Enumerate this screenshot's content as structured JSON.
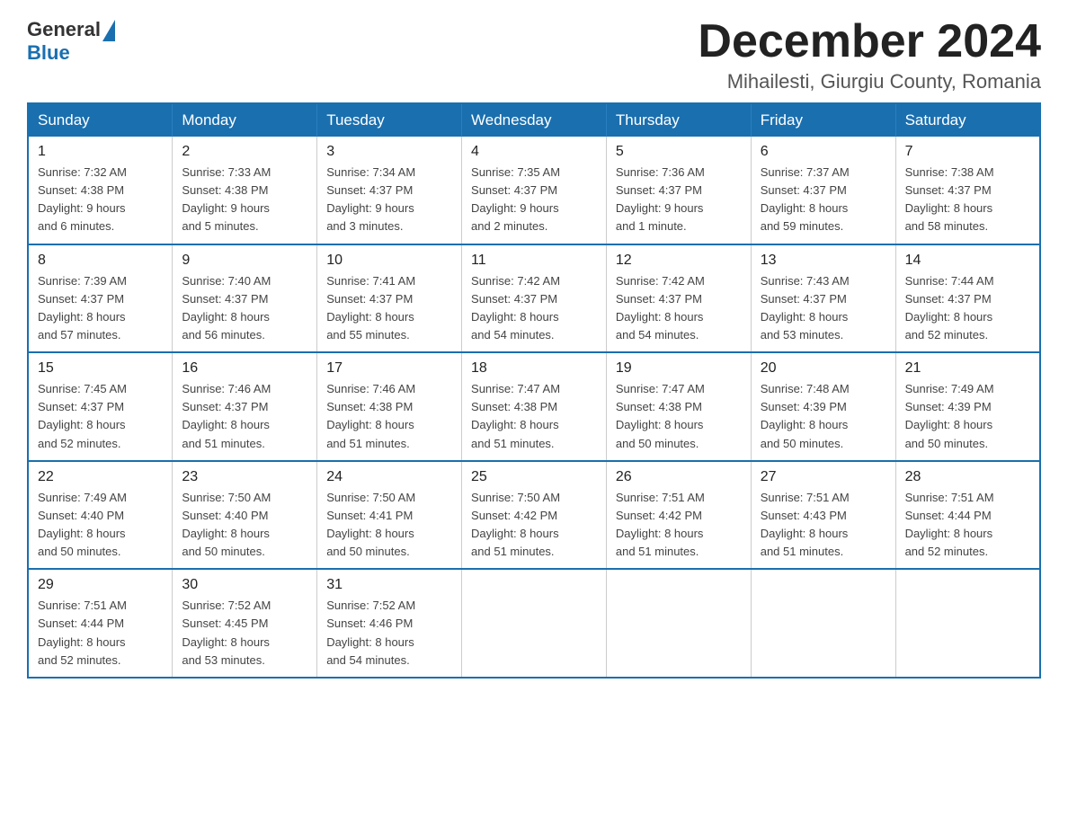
{
  "header": {
    "logo_general": "General",
    "logo_blue": "Blue",
    "month_title": "December 2024",
    "location": "Mihailesti, Giurgiu County, Romania"
  },
  "days_of_week": [
    "Sunday",
    "Monday",
    "Tuesday",
    "Wednesday",
    "Thursday",
    "Friday",
    "Saturday"
  ],
  "weeks": [
    [
      {
        "day": "1",
        "sunrise": "7:32 AM",
        "sunset": "4:38 PM",
        "daylight": "9 hours and 6 minutes."
      },
      {
        "day": "2",
        "sunrise": "7:33 AM",
        "sunset": "4:38 PM",
        "daylight": "9 hours and 5 minutes."
      },
      {
        "day": "3",
        "sunrise": "7:34 AM",
        "sunset": "4:37 PM",
        "daylight": "9 hours and 3 minutes."
      },
      {
        "day": "4",
        "sunrise": "7:35 AM",
        "sunset": "4:37 PM",
        "daylight": "9 hours and 2 minutes."
      },
      {
        "day": "5",
        "sunrise": "7:36 AM",
        "sunset": "4:37 PM",
        "daylight": "9 hours and 1 minute."
      },
      {
        "day": "6",
        "sunrise": "7:37 AM",
        "sunset": "4:37 PM",
        "daylight": "8 hours and 59 minutes."
      },
      {
        "day": "7",
        "sunrise": "7:38 AM",
        "sunset": "4:37 PM",
        "daylight": "8 hours and 58 minutes."
      }
    ],
    [
      {
        "day": "8",
        "sunrise": "7:39 AM",
        "sunset": "4:37 PM",
        "daylight": "8 hours and 57 minutes."
      },
      {
        "day": "9",
        "sunrise": "7:40 AM",
        "sunset": "4:37 PM",
        "daylight": "8 hours and 56 minutes."
      },
      {
        "day": "10",
        "sunrise": "7:41 AM",
        "sunset": "4:37 PM",
        "daylight": "8 hours and 55 minutes."
      },
      {
        "day": "11",
        "sunrise": "7:42 AM",
        "sunset": "4:37 PM",
        "daylight": "8 hours and 54 minutes."
      },
      {
        "day": "12",
        "sunrise": "7:42 AM",
        "sunset": "4:37 PM",
        "daylight": "8 hours and 54 minutes."
      },
      {
        "day": "13",
        "sunrise": "7:43 AM",
        "sunset": "4:37 PM",
        "daylight": "8 hours and 53 minutes."
      },
      {
        "day": "14",
        "sunrise": "7:44 AM",
        "sunset": "4:37 PM",
        "daylight": "8 hours and 52 minutes."
      }
    ],
    [
      {
        "day": "15",
        "sunrise": "7:45 AM",
        "sunset": "4:37 PM",
        "daylight": "8 hours and 52 minutes."
      },
      {
        "day": "16",
        "sunrise": "7:46 AM",
        "sunset": "4:37 PM",
        "daylight": "8 hours and 51 minutes."
      },
      {
        "day": "17",
        "sunrise": "7:46 AM",
        "sunset": "4:38 PM",
        "daylight": "8 hours and 51 minutes."
      },
      {
        "day": "18",
        "sunrise": "7:47 AM",
        "sunset": "4:38 PM",
        "daylight": "8 hours and 51 minutes."
      },
      {
        "day": "19",
        "sunrise": "7:47 AM",
        "sunset": "4:38 PM",
        "daylight": "8 hours and 50 minutes."
      },
      {
        "day": "20",
        "sunrise": "7:48 AM",
        "sunset": "4:39 PM",
        "daylight": "8 hours and 50 minutes."
      },
      {
        "day": "21",
        "sunrise": "7:49 AM",
        "sunset": "4:39 PM",
        "daylight": "8 hours and 50 minutes."
      }
    ],
    [
      {
        "day": "22",
        "sunrise": "7:49 AM",
        "sunset": "4:40 PM",
        "daylight": "8 hours and 50 minutes."
      },
      {
        "day": "23",
        "sunrise": "7:50 AM",
        "sunset": "4:40 PM",
        "daylight": "8 hours and 50 minutes."
      },
      {
        "day": "24",
        "sunrise": "7:50 AM",
        "sunset": "4:41 PM",
        "daylight": "8 hours and 50 minutes."
      },
      {
        "day": "25",
        "sunrise": "7:50 AM",
        "sunset": "4:42 PM",
        "daylight": "8 hours and 51 minutes."
      },
      {
        "day": "26",
        "sunrise": "7:51 AM",
        "sunset": "4:42 PM",
        "daylight": "8 hours and 51 minutes."
      },
      {
        "day": "27",
        "sunrise": "7:51 AM",
        "sunset": "4:43 PM",
        "daylight": "8 hours and 51 minutes."
      },
      {
        "day": "28",
        "sunrise": "7:51 AM",
        "sunset": "4:44 PM",
        "daylight": "8 hours and 52 minutes."
      }
    ],
    [
      {
        "day": "29",
        "sunrise": "7:51 AM",
        "sunset": "4:44 PM",
        "daylight": "8 hours and 52 minutes."
      },
      {
        "day": "30",
        "sunrise": "7:52 AM",
        "sunset": "4:45 PM",
        "daylight": "8 hours and 53 minutes."
      },
      {
        "day": "31",
        "sunrise": "7:52 AM",
        "sunset": "4:46 PM",
        "daylight": "8 hours and 54 minutes."
      },
      null,
      null,
      null,
      null
    ]
  ],
  "labels": {
    "sunrise": "Sunrise:",
    "sunset": "Sunset:",
    "daylight": "Daylight:"
  }
}
